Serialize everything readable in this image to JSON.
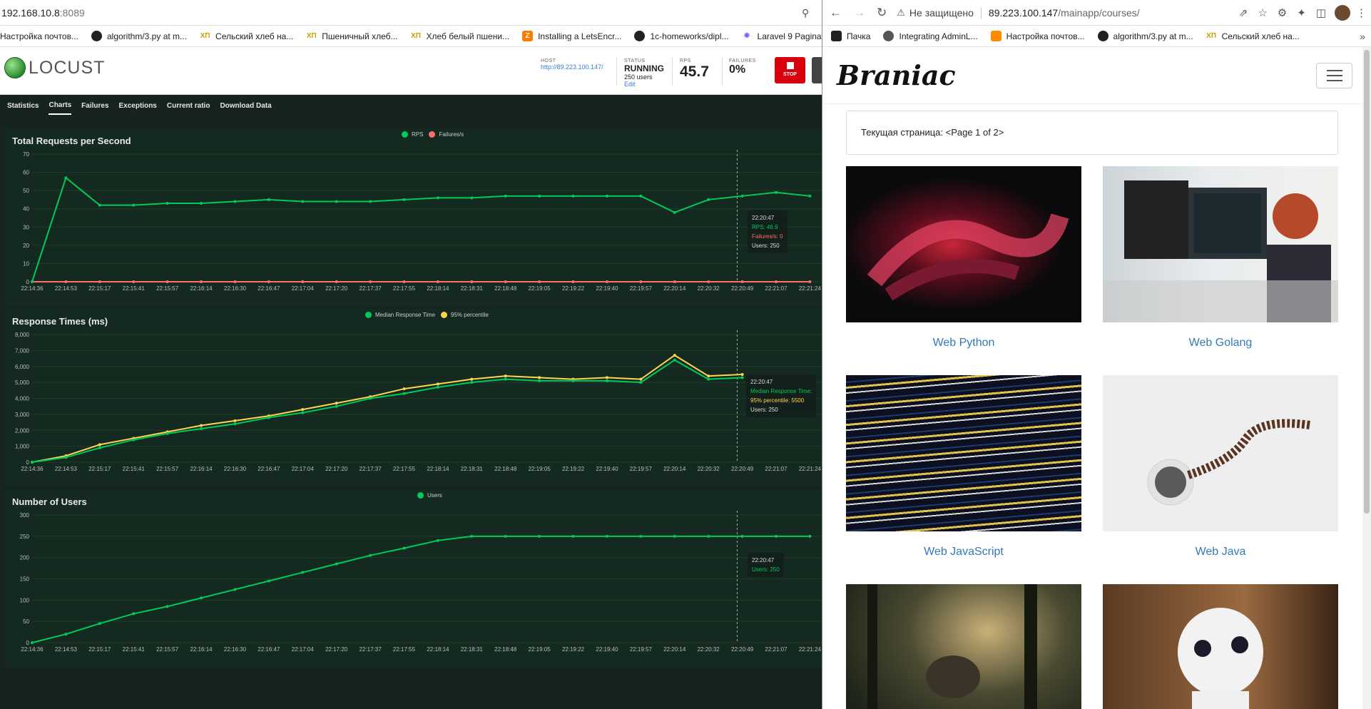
{
  "left": {
    "address": {
      "host": "192.168.10.8",
      "port": ":8089"
    },
    "bookmarks": [
      "Настройка почтов...",
      "algorithm/3.py at m...",
      "Сельский хлеб на...",
      "Пшеничный хлеб...",
      "Хлеб белый пшени...",
      "Installing a LetsEncr...",
      "1c-homeworks/dipl...",
      "Laravel 9 Paginat"
    ],
    "locust": {
      "logo": "LOCUST",
      "host_label": "HOST",
      "host": "http://89.223.100.147/",
      "status_label": "STATUS",
      "status": "RUNNING",
      "users": "250 users",
      "edit": "Edit",
      "rps_label": "RPS",
      "rps": "45.7",
      "failures_label": "FAILURES",
      "failures": "0%",
      "stop": "STOP"
    },
    "tabs": [
      "Statistics",
      "Charts",
      "Failures",
      "Exceptions",
      "Current ratio",
      "Download Data"
    ],
    "tooltips": {
      "rps": {
        "time": "22:20:47",
        "rps": "RPS: 46.9",
        "fail": "Failures/s: 0",
        "users": "Users: 250"
      },
      "resp": {
        "time": "22:20:47",
        "median": "Median Response Time:",
        "p95": "95% percentile: 5500",
        "users": "Users: 250"
      },
      "users": {
        "time": "22:20:47",
        "users": "Users: 250"
      }
    }
  },
  "chart_data": [
    {
      "type": "line",
      "title": "Total Requests per Second",
      "x": [
        "22:14:36",
        "22:14:53",
        "22:15:17",
        "22:15:41",
        "22:15:57",
        "22:16:14",
        "22:16:30",
        "22:16:47",
        "22:17:04",
        "22:17:20",
        "22:17:37",
        "22:17:55",
        "22:18:14",
        "22:18:31",
        "22:18:48",
        "22:19:05",
        "22:19:22",
        "22:19:40",
        "22:19:57",
        "22:20:14",
        "22:20:32",
        "22:20:49",
        "22:21:07",
        "22:21:24"
      ],
      "series": [
        {
          "name": "RPS",
          "color": "#00ca5a",
          "values": [
            0,
            57,
            42,
            42,
            43,
            43,
            44,
            45,
            44,
            44,
            44,
            45,
            46,
            46,
            47,
            47,
            47,
            47,
            47,
            38,
            45,
            47,
            49,
            47
          ]
        },
        {
          "name": "Failures/s",
          "color": "#ff6d6d",
          "values": [
            0,
            0,
            0,
            0,
            0,
            0,
            0,
            0,
            0,
            0,
            0,
            0,
            0,
            0,
            0,
            0,
            0,
            0,
            0,
            0,
            0,
            0,
            0,
            0
          ]
        }
      ],
      "yticks": [
        0,
        10,
        20,
        30,
        40,
        50,
        60,
        70
      ],
      "ylim": [
        0,
        70
      ],
      "legend": "top"
    },
    {
      "type": "line",
      "title": "Response Times (ms)",
      "x": [
        "22:14:36",
        "22:14:53",
        "22:15:17",
        "22:15:41",
        "22:15:57",
        "22:16:14",
        "22:16:30",
        "22:16:47",
        "22:17:04",
        "22:17:20",
        "22:17:37",
        "22:17:55",
        "22:18:14",
        "22:18:31",
        "22:18:48",
        "22:19:05",
        "22:19:22",
        "22:19:40",
        "22:19:57",
        "22:20:14",
        "22:20:32",
        "22:20:49",
        "22:21:07",
        "22:21:24"
      ],
      "series": [
        {
          "name": "Median Response Time",
          "color": "#00ca5a",
          "values": [
            0,
            300,
            900,
            1400,
            1800,
            2100,
            2400,
            2800,
            3100,
            3500,
            4000,
            4300,
            4700,
            5000,
            5200,
            5100,
            5100,
            5100,
            5000,
            6400,
            5200,
            5300,
            null,
            null
          ]
        },
        {
          "name": "95% percentile",
          "color": "#ffd54f",
          "values": [
            0,
            400,
            1100,
            1500,
            1900,
            2300,
            2600,
            2900,
            3300,
            3700,
            4100,
            4600,
            4900,
            5200,
            5400,
            5300,
            5200,
            5300,
            5200,
            6700,
            5400,
            5500,
            null,
            null
          ]
        }
      ],
      "yticks": [
        "0",
        "1,000",
        "2,000",
        "3,000",
        "4,000",
        "5,000",
        "6,000",
        "7,000",
        "8,000"
      ],
      "ylim": [
        0,
        8000
      ],
      "legend": "top"
    },
    {
      "type": "line",
      "title": "Number of Users",
      "x": [
        "22:14:36",
        "22:14:53",
        "22:15:17",
        "22:15:41",
        "22:15:57",
        "22:16:14",
        "22:16:30",
        "22:16:47",
        "22:17:04",
        "22:17:20",
        "22:17:37",
        "22:17:55",
        "22:18:14",
        "22:18:31",
        "22:18:48",
        "22:19:05",
        "22:19:22",
        "22:19:40",
        "22:19:57",
        "22:20:14",
        "22:20:32",
        "22:20:49",
        "22:21:07",
        "22:21:24"
      ],
      "series": [
        {
          "name": "Users",
          "color": "#00ca5a",
          "values": [
            0,
            20,
            45,
            68,
            85,
            105,
            125,
            145,
            165,
            185,
            205,
            222,
            240,
            250,
            250,
            250,
            250,
            250,
            250,
            250,
            250,
            250,
            250,
            250
          ]
        }
      ],
      "yticks": [
        0,
        50,
        100,
        150,
        200,
        250,
        300
      ],
      "ylim": [
        0,
        300
      ],
      "legend": "top"
    }
  ],
  "right": {
    "address": {
      "warning": "Не защищено",
      "host": "89.223.100.147",
      "path": "/mainapp/courses/"
    },
    "bookmarks": [
      "Пачка",
      "Integrating AdminL...",
      "Настройка почтов...",
      "algorithm/3.py at m...",
      "Сельский хлеб на..."
    ],
    "brand": "Braniac",
    "pager": "Текущая страница: <Page 1 of 2>",
    "courses": [
      "Web Python",
      "Web Golang",
      "Web JavaScript",
      "Web Java",
      "",
      ""
    ]
  }
}
